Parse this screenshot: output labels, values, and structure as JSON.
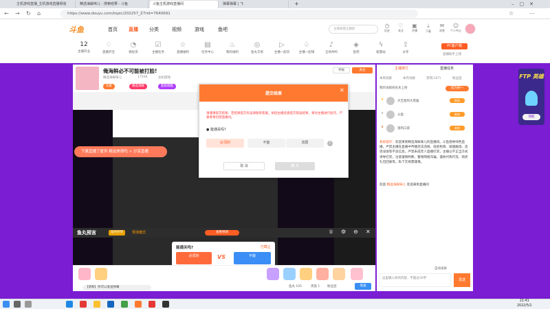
{
  "browser": {
    "tabs": [
      {
        "label": "主机游戏直播_主机游戏直播频道"
      },
      {
        "label": "精选海解味儿 - 搜索结果 - 斗鱼"
      },
      {
        "label": "斗鱼主机游戏直播间"
      },
      {
        "label": "弹幕弹幕 | 飞"
      }
    ],
    "url": "https://www.douyu.com/topic/202257_Z7rid=7640691"
  },
  "site": {
    "nav": [
      "首页",
      "直播",
      "分类",
      "视频",
      "游戏",
      "鱼吧"
    ],
    "search_placeholder": "主播掌握正翻影",
    "header_icons": [
      "历史",
      "关注",
      "开播",
      "下载",
      "消息",
      "鱼丸",
      "个人中心"
    ],
    "categories": [
      "主播开业",
      "直播开宝",
      "微投资",
      "主播任务",
      "直播福利",
      "任务中心",
      "我的福利",
      "鱼丸交易",
      "主播一起玩",
      "主播一起嗨",
      "全场共鸣",
      "鱼吧",
      "能量站",
      "分享"
    ],
    "pc_button": "PC客户端",
    "pc_sub": "直播助手上线",
    "count_number": "12"
  },
  "stream": {
    "title": "俺海鲜必不可能被打脸!",
    "streamer": "精选海鲜味儿",
    "fans": "17508",
    "category": "主机游戏",
    "report": "举报",
    "follow": "关注",
    "tags": [
      "玩家",
      "精选海鲜",
      "超级跑酷"
    ],
    "float_label": "下属直播了盛世 精选美观吗 > 分享直播",
    "prediction": {
      "title": "鱼丸预言",
      "tag": "准时开奖",
      "mode": "预测模式",
      "button": "查看预测",
      "question": "能通关吗?",
      "status": "已截止",
      "option_a": "必须的",
      "option_b": "不能",
      "vs": "VS",
      "cancel": "取消",
      "confirm": "结束"
    },
    "danmu_placeholder": "【请和】你可以发送弹幕",
    "stats": [
      "鱼丸 105",
      "贵族 1",
      "粉丝团"
    ],
    "send": "发送"
  },
  "modal": {
    "title": "提交结果",
    "desc": "请谨慎提交结果，若结果提交有误请联系客服。如因主播恶意提交错误结果，将对主播进行处罚，严重者将封禁直播间。",
    "question": "能通关吗?",
    "options": [
      "必须的",
      "不能",
      "流局"
    ],
    "cancel": "取 消",
    "confirm": "确 定"
  },
  "right_panel": {
    "tabs": [
      "主播排行",
      "直播任务"
    ],
    "subtabs": [
      "本周贡献",
      "本月贡献",
      "贵宾(107)",
      "粉丝团"
    ],
    "my_rank": "我的贡献排名未上榜",
    "rank_button": "成为榜一",
    "rank_items": [
      "大吉星的大黑猫",
      "斗鱼",
      "渣鸡口袋"
    ],
    "rank_tags": [
      "贵宾",
      "贵宾",
      "贵宾"
    ],
    "chat_system": "系统提示：",
    "chat_text": "欢迎来到精选海鲜味儿的直播间。斗鱼倡导绿色直播，严禁主播在直播中传播违法违规、低俗色情、吸烟酗酒、造谣诽谤等不良信息。严禁未成年人直播打赏，主播以不正当方式诱导打赏，注意谨慎判断，警惕网络诈骗，谨防代练代充、购买礼包回收等，私下交易需谨慎。",
    "welcome_prefix": "欢迎",
    "welcome_name": "精选海鲜味儿",
    "welcome_suffix": "欢迎来到直播间",
    "auto_roll": "自动滚屏",
    "input_placeholder": "这里输入你的内容，不超过30字",
    "send": "发送"
  },
  "promo": {
    "title": "FTP 英雄",
    "label": "领取"
  },
  "taskbar": {
    "time": "21:41",
    "date": "2022/5/1"
  },
  "colors": {
    "accent": "#ff5d23",
    "purple": "#7a1dd3",
    "orange": "#ff7a30",
    "blue": "#3a8ef5"
  }
}
